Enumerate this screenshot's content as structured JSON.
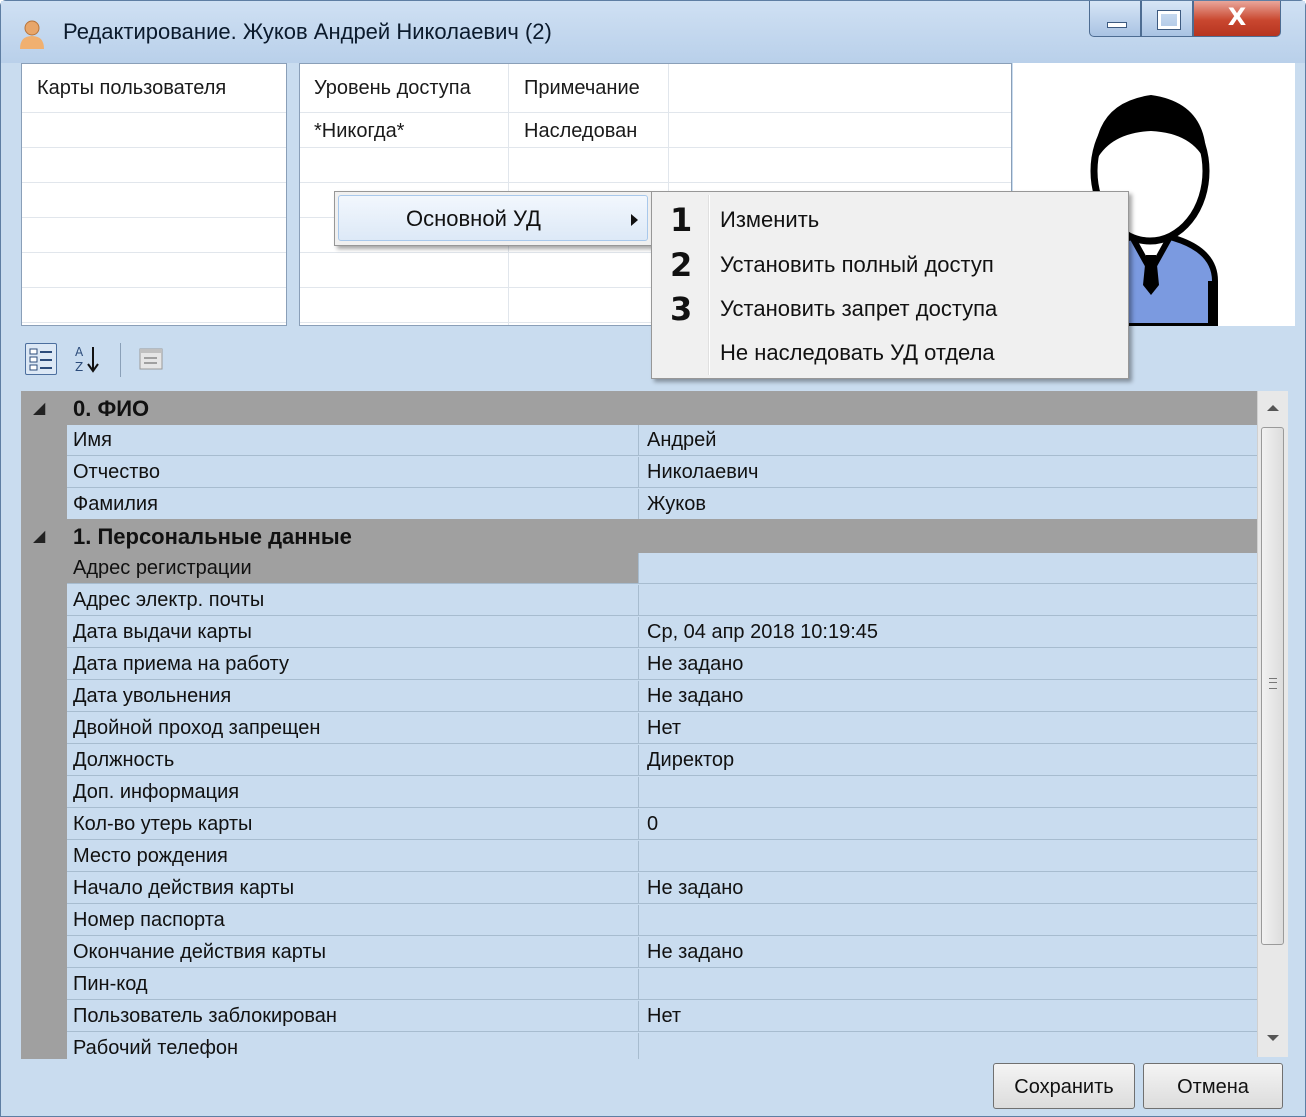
{
  "window": {
    "title": "Редактирование. Жуков Андрей Николаевич (2)",
    "close_glyph": "X"
  },
  "cards_panel": {
    "header": "Карты пользователя"
  },
  "access_panel": {
    "columns": [
      "Уровень доступа",
      "Примечание"
    ],
    "rows": [
      {
        "level": "*Никогда*",
        "note": "Наследован"
      }
    ]
  },
  "context_menu": {
    "item": "Основной УД"
  },
  "submenu": {
    "items": [
      {
        "num": "1",
        "label": "Изменить"
      },
      {
        "num": "2",
        "label": "Установить полный доступ"
      },
      {
        "num": "3",
        "label": "Установить запрет доступа"
      },
      {
        "num": "",
        "label": "Не наследовать УД отдела"
      }
    ]
  },
  "toolbar": {
    "icons": [
      "categorized-icon",
      "sort-alpha-icon",
      "property-pages-icon"
    ]
  },
  "properties": {
    "categories": [
      {
        "title": "0. ФИО",
        "rows": [
          {
            "name": "Имя",
            "value": "Андрей"
          },
          {
            "name": "Отчество",
            "value": "Николаевич"
          },
          {
            "name": "Фамилия",
            "value": "Жуков"
          }
        ]
      },
      {
        "title": "1. Персональные данные",
        "rows": [
          {
            "name": "Адрес регистрации",
            "value": ""
          },
          {
            "name": "Адрес электр. почты",
            "value": ""
          },
          {
            "name": "Дата выдачи карты",
            "value": "Ср, 04 апр 2018 10:19:45"
          },
          {
            "name": "Дата приема на работу",
            "value": "Не задано"
          },
          {
            "name": "Дата увольнения",
            "value": "Не задано"
          },
          {
            "name": "Двойной проход запрещен",
            "value": "Нет"
          },
          {
            "name": "Должность",
            "value": "Директор"
          },
          {
            "name": "Доп. информация",
            "value": ""
          },
          {
            "name": "Кол-во утерь карты",
            "value": "0"
          },
          {
            "name": "Место рождения",
            "value": ""
          },
          {
            "name": "Начало действия карты",
            "value": "Не задано"
          },
          {
            "name": "Номер паспорта",
            "value": ""
          },
          {
            "name": "Окончание действия карты",
            "value": "Не задано"
          },
          {
            "name": "Пин-код",
            "value": ""
          },
          {
            "name": "Пользователь заблокирован",
            "value": "Нет"
          },
          {
            "name": "Рабочий телефон",
            "value": ""
          }
        ]
      }
    ]
  },
  "buttons": {
    "save": "Сохранить",
    "cancel": "Отмена"
  },
  "colors": {
    "window_bg": "#c9dcef",
    "category_bg": "#a0a0a0",
    "close_red": "#c9472f"
  }
}
